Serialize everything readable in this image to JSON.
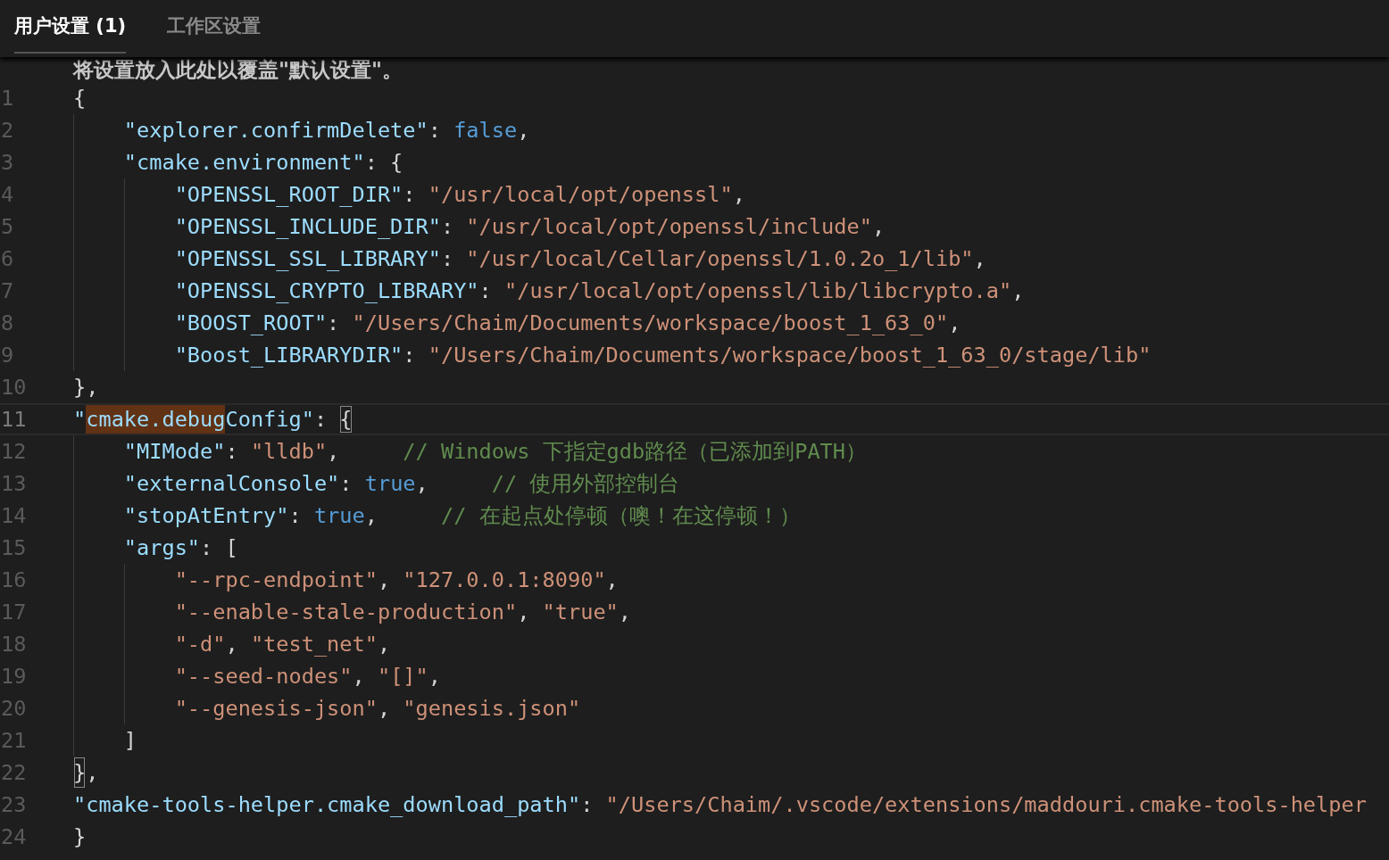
{
  "tabs": [
    {
      "label": "用户设置 (1)",
      "selected": true
    },
    {
      "label": "工作区设置",
      "selected": false
    }
  ],
  "editor": {
    "hint": "将设置放入此处以覆盖\"默认设置\"。",
    "lines": [
      {
        "number": "1",
        "current": false,
        "tokens": [
          {
            "kind": "punct",
            "text": "{"
          }
        ]
      },
      {
        "number": "2",
        "current": false,
        "tokens": [
          {
            "kind": "key",
            "text": "    \"explorer.confirmDelete\""
          },
          {
            "kind": "punct",
            "text": ": "
          },
          {
            "kind": "keyword",
            "text": "false"
          },
          {
            "kind": "punct",
            "text": ","
          }
        ]
      },
      {
        "number": "3",
        "current": false,
        "tokens": [
          {
            "kind": "key",
            "text": "    \"cmake.environment\""
          },
          {
            "kind": "punct",
            "text": ": {"
          }
        ]
      },
      {
        "number": "4",
        "current": false,
        "tokens": [
          {
            "kind": "key",
            "text": "        \"OPENSSL_ROOT_DIR\""
          },
          {
            "kind": "punct",
            "text": ": "
          },
          {
            "kind": "string",
            "text": "\"/usr/local/opt/openssl\""
          },
          {
            "kind": "punct",
            "text": ","
          }
        ]
      },
      {
        "number": "5",
        "current": false,
        "tokens": [
          {
            "kind": "key",
            "text": "        \"OPENSSL_INCLUDE_DIR\""
          },
          {
            "kind": "punct",
            "text": ": "
          },
          {
            "kind": "string",
            "text": "\"/usr/local/opt/openssl/include\""
          },
          {
            "kind": "punct",
            "text": ","
          }
        ]
      },
      {
        "number": "6",
        "current": false,
        "tokens": [
          {
            "kind": "key",
            "text": "        \"OPENSSL_SSL_LIBRARY\""
          },
          {
            "kind": "punct",
            "text": ": "
          },
          {
            "kind": "string",
            "text": "\"/usr/local/Cellar/openssl/1.0.2o_1/lib\""
          },
          {
            "kind": "punct",
            "text": ","
          }
        ]
      },
      {
        "number": "7",
        "current": false,
        "tokens": [
          {
            "kind": "key",
            "text": "        \"OPENSSL_CRYPTO_LIBRARY\""
          },
          {
            "kind": "punct",
            "text": ": "
          },
          {
            "kind": "string",
            "text": "\"/usr/local/opt/openssl/lib/libcrypto.a\""
          },
          {
            "kind": "punct",
            "text": ","
          }
        ]
      },
      {
        "number": "8",
        "current": false,
        "tokens": [
          {
            "kind": "key",
            "text": "        \"BOOST_ROOT\""
          },
          {
            "kind": "punct",
            "text": ": "
          },
          {
            "kind": "string",
            "text": "\"/Users/Chaim/Documents/workspace/boost_1_63_0\""
          },
          {
            "kind": "punct",
            "text": ","
          }
        ]
      },
      {
        "number": "9",
        "current": false,
        "tokens": [
          {
            "kind": "key",
            "text": "        \"Boost_LIBRARYDIR\""
          },
          {
            "kind": "punct",
            "text": ": "
          },
          {
            "kind": "string",
            "text": "\"/Users/Chaim/Documents/workspace/boost_1_63_0/stage/lib\""
          }
        ]
      },
      {
        "number": "10",
        "current": false,
        "tokens": [
          {
            "kind": "punct",
            "text": "},"
          }
        ]
      },
      {
        "number": "11",
        "current": true,
        "tokens": [
          {
            "kind": "key",
            "text": "\""
          },
          {
            "kind": "key",
            "text": "cmake.debug",
            "highlighted": true
          },
          {
            "kind": "key",
            "text": "Config\""
          },
          {
            "kind": "punct",
            "text": ": "
          },
          {
            "kind": "punct",
            "text": "{",
            "bracket_match": true
          }
        ]
      },
      {
        "number": "12",
        "current": false,
        "tokens": [
          {
            "kind": "key",
            "text": "    \"MIMode\""
          },
          {
            "kind": "punct",
            "text": ": "
          },
          {
            "kind": "string",
            "text": "\"lldb\""
          },
          {
            "kind": "punct",
            "text": ",     "
          },
          {
            "kind": "comment",
            "text": "// Windows 下指定gdb路径（已添加到PATH）"
          }
        ]
      },
      {
        "number": "13",
        "current": false,
        "tokens": [
          {
            "kind": "key",
            "text": "    \"externalConsole\""
          },
          {
            "kind": "punct",
            "text": ": "
          },
          {
            "kind": "keyword",
            "text": "true"
          },
          {
            "kind": "punct",
            "text": ",     "
          },
          {
            "kind": "comment",
            "text": "// 使用外部控制台"
          }
        ]
      },
      {
        "number": "14",
        "current": false,
        "tokens": [
          {
            "kind": "key",
            "text": "    \"stopAtEntry\""
          },
          {
            "kind": "punct",
            "text": ": "
          },
          {
            "kind": "keyword",
            "text": "true"
          },
          {
            "kind": "punct",
            "text": ",     "
          },
          {
            "kind": "comment",
            "text": "// 在起点处停顿（噢！在这停顿！）"
          }
        ]
      },
      {
        "number": "15",
        "current": false,
        "tokens": [
          {
            "kind": "key",
            "text": "    \"args\""
          },
          {
            "kind": "punct",
            "text": ": ["
          }
        ]
      },
      {
        "number": "16",
        "current": false,
        "tokens": [
          {
            "kind": "string",
            "text": "        \"--rpc-endpoint\""
          },
          {
            "kind": "punct",
            "text": ", "
          },
          {
            "kind": "string",
            "text": "\"127.0.0.1:8090\""
          },
          {
            "kind": "punct",
            "text": ","
          }
        ]
      },
      {
        "number": "17",
        "current": false,
        "tokens": [
          {
            "kind": "string",
            "text": "        \"--enable-stale-production\""
          },
          {
            "kind": "punct",
            "text": ", "
          },
          {
            "kind": "string",
            "text": "\"true\""
          },
          {
            "kind": "punct",
            "text": ","
          }
        ]
      },
      {
        "number": "18",
        "current": false,
        "tokens": [
          {
            "kind": "string",
            "text": "        \"-d\""
          },
          {
            "kind": "punct",
            "text": ", "
          },
          {
            "kind": "string",
            "text": "\"test_net\""
          },
          {
            "kind": "punct",
            "text": ","
          }
        ]
      },
      {
        "number": "19",
        "current": false,
        "tokens": [
          {
            "kind": "string",
            "text": "        \"--seed-nodes\""
          },
          {
            "kind": "punct",
            "text": ", "
          },
          {
            "kind": "string",
            "text": "\"[]\""
          },
          {
            "kind": "punct",
            "text": ","
          }
        ]
      },
      {
        "number": "20",
        "current": false,
        "tokens": [
          {
            "kind": "string",
            "text": "        \"--genesis-json\""
          },
          {
            "kind": "punct",
            "text": ", "
          },
          {
            "kind": "string",
            "text": "\"genesis.json\""
          }
        ]
      },
      {
        "number": "21",
        "current": false,
        "tokens": [
          {
            "kind": "punct",
            "text": "    ]"
          }
        ]
      },
      {
        "number": "22",
        "current": false,
        "tokens": [
          {
            "kind": "punct",
            "text": "}",
            "bracket_match": true
          },
          {
            "kind": "punct",
            "text": ","
          }
        ]
      },
      {
        "number": "23",
        "current": false,
        "tokens": [
          {
            "kind": "key",
            "text": "\"cmake-tools-helper.cmake_download_path\""
          },
          {
            "kind": "punct",
            "text": ": "
          },
          {
            "kind": "string",
            "text": "\"/Users/Chaim/.vscode/extensions/maddouri.cmake-tools-helper"
          }
        ]
      },
      {
        "number": "24",
        "current": false,
        "tokens": [
          {
            "kind": "punct",
            "text": "}"
          }
        ]
      }
    ]
  }
}
